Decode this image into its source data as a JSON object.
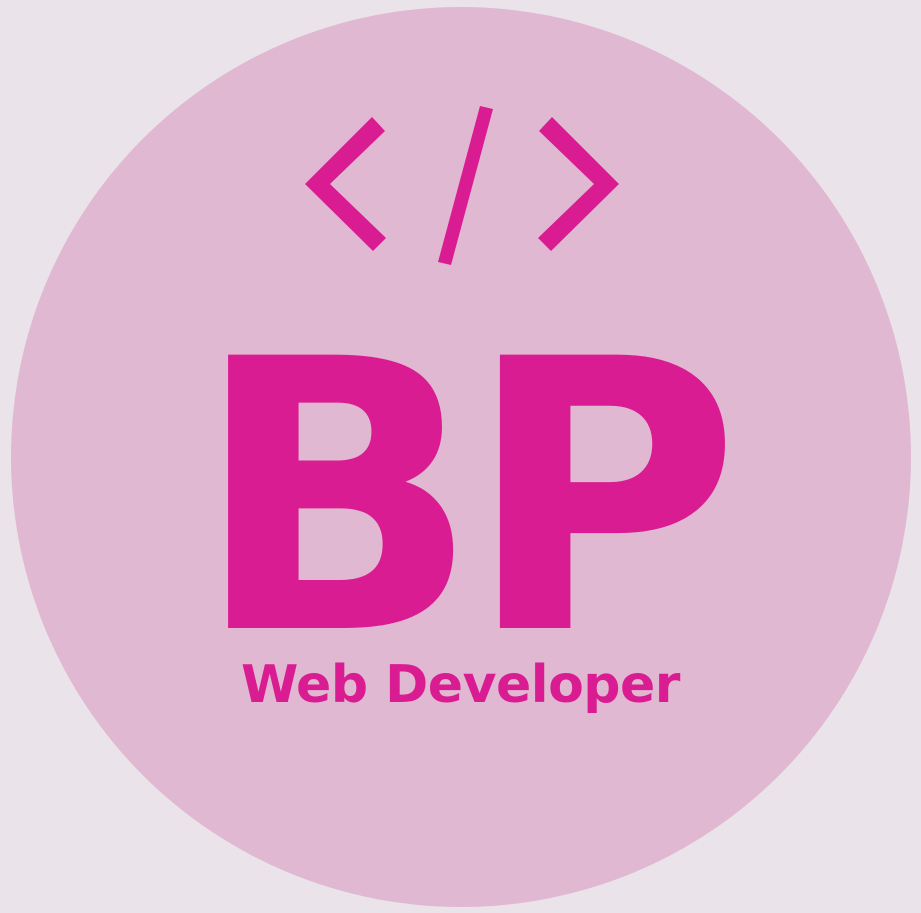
{
  "logo": {
    "monogram": "BP",
    "tagline": "Web Developer",
    "code_icon": "code-brackets-icon"
  },
  "colors": {
    "page_background": "#ebe3ea",
    "circle_fill": "#e0b8d1",
    "accent": "#d91c91"
  }
}
